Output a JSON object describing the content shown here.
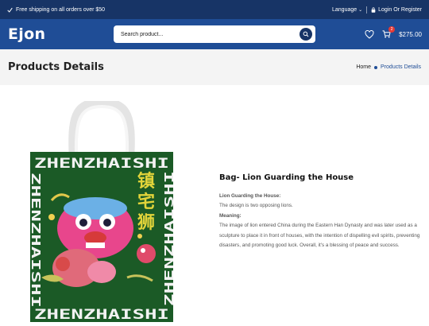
{
  "topbar": {
    "shipping": "Free shipping on all orders over $50",
    "language": "Language",
    "login": "Login Or Register"
  },
  "header": {
    "logo": "Ejon",
    "search_placeholder": "Search product...",
    "cart_count": "2",
    "cart_total": "$275.00"
  },
  "page": {
    "title": "Products Details",
    "breadcrumb": [
      "Home",
      "Products Details"
    ]
  },
  "product": {
    "name": "Bag- Lion Guarding the House",
    "label1": "Lion Guarding the House:",
    "text1": "The design is two opposing lions.",
    "label2": "Meaning:",
    "text2": "The image of lion entered China during the Eastern Han Dynasty and was later used as a sculpture to place it in front of houses, with the intention of dispelling evil spirits, preventing disasters, and promoting good luck. Overall, it's a blessing of peace and success.",
    "print_text": "ZHENZHAISHI",
    "print_chars": [
      "镇",
      "宅",
      "狮"
    ]
  },
  "colors": {
    "topbar": "#173466",
    "header": "#1f4d96",
    "bag_green": "#1b5a26",
    "char_yellow": "#e2d43a"
  }
}
